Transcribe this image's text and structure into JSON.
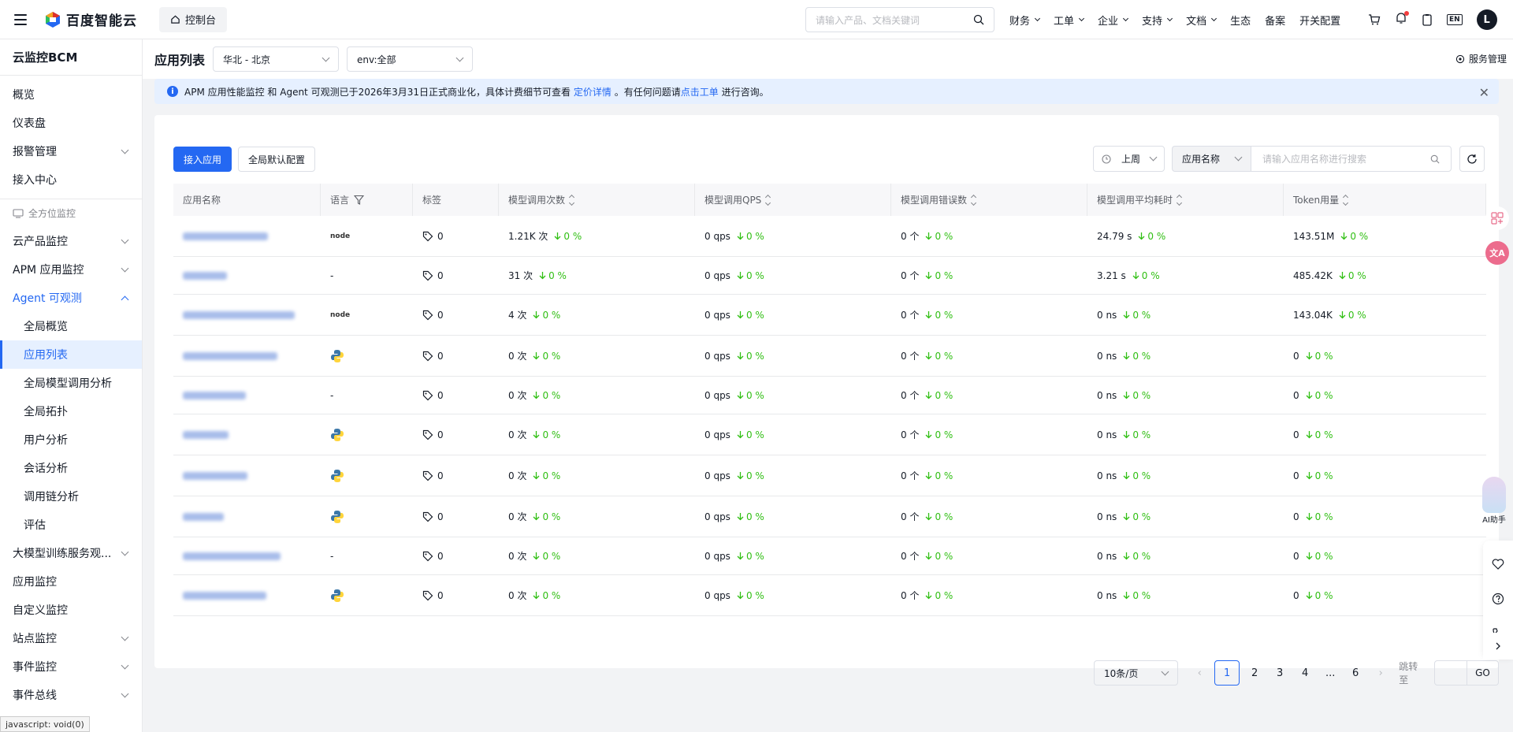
{
  "topbar": {
    "logo_text": "百度智能云",
    "console_label": "控制台",
    "search_placeholder": "请输入产品、文档关键词",
    "nav": [
      {
        "label": "财务",
        "dropdown": true
      },
      {
        "label": "工单",
        "dropdown": true
      },
      {
        "label": "企业",
        "dropdown": true
      },
      {
        "label": "支持",
        "dropdown": true
      },
      {
        "label": "文档",
        "dropdown": true
      },
      {
        "label": "生态",
        "dropdown": false
      },
      {
        "label": "备案",
        "dropdown": false
      },
      {
        "label": "开关配置",
        "dropdown": false
      }
    ],
    "lang_label": "EN",
    "avatar_letter": "L"
  },
  "sidebar": {
    "title": "云监控BCM",
    "items": [
      {
        "label": "概览"
      },
      {
        "label": "仪表盘"
      },
      {
        "label": "报警管理",
        "chevron": true
      },
      {
        "label": "接入中心"
      }
    ],
    "group_label": "全方位监控",
    "items2": [
      {
        "label": "云产品监控",
        "chevron": true
      },
      {
        "label": "APM 应用监控",
        "chevron": true
      },
      {
        "label": "Agent 可观测",
        "chevron": true,
        "open": true
      }
    ],
    "subitems": [
      {
        "label": "全局概览"
      },
      {
        "label": "应用列表",
        "active": true
      },
      {
        "label": "全局模型调用分析"
      },
      {
        "label": "全局拓扑"
      },
      {
        "label": "用户分析"
      },
      {
        "label": "会话分析"
      },
      {
        "label": "调用链分析"
      },
      {
        "label": "评估"
      }
    ],
    "items3": [
      {
        "label": "大模型训练服务观...",
        "chevron": true
      },
      {
        "label": "应用监控"
      },
      {
        "label": "自定义监控"
      },
      {
        "label": "站点监控",
        "chevron": true
      },
      {
        "label": "事件监控",
        "chevron": true
      },
      {
        "label": "事件总线",
        "chevron": true
      }
    ],
    "status_tip": "javascript: void(0)"
  },
  "page": {
    "title": "应用列表",
    "region": "华北 - 北京",
    "env": "env:全部",
    "service_mgmt": "服务管理"
  },
  "notice": {
    "text1": "APM 应用性能监控 和 Agent 可观测已于2026年3月31日正式商业化，具体计费细节可查看",
    "link1": "定价详情",
    "text2": "。有任何问题请",
    "link2": "点击工单",
    "text3": "进行咨询。"
  },
  "toolbar": {
    "add_app": "接入应用",
    "global_config": "全局默认配置",
    "time_range": "上周",
    "search_field": "应用名称",
    "search_placeholder": "请输入应用名称进行搜索"
  },
  "table": {
    "headers": [
      "应用名称",
      "语言",
      "标签",
      "模型调用次数",
      "模型调用QPS",
      "模型调用错误数",
      "模型调用平均耗时",
      "Token用量"
    ],
    "rows": [
      {
        "lang": "node",
        "tags": "0",
        "calls": "1.21K 次",
        "calls_t": "0 %",
        "qps": "0 qps",
        "qps_t": "0 %",
        "err": "0 个",
        "err_t": "0 %",
        "lat": "24.79 s",
        "lat_t": "0 %",
        "tok": "143.51M",
        "tok_t": "0 %"
      },
      {
        "lang": "-",
        "tags": "0",
        "calls": "31 次",
        "calls_t": "0 %",
        "qps": "0 qps",
        "qps_t": "0 %",
        "err": "0 个",
        "err_t": "0 %",
        "lat": "3.21 s",
        "lat_t": "0 %",
        "tok": "485.42K",
        "tok_t": "0 %"
      },
      {
        "lang": "node",
        "tags": "0",
        "calls": "4 次",
        "calls_t": "0 %",
        "qps": "0 qps",
        "qps_t": "0 %",
        "err": "0 个",
        "err_t": "0 %",
        "lat": "0 ns",
        "lat_t": "0 %",
        "tok": "143.04K",
        "tok_t": "0 %"
      },
      {
        "lang": "python",
        "tags": "0",
        "calls": "0 次",
        "calls_t": "0 %",
        "qps": "0 qps",
        "qps_t": "0 %",
        "err": "0 个",
        "err_t": "0 %",
        "lat": "0 ns",
        "lat_t": "0 %",
        "tok": "0",
        "tok_t": "0 %"
      },
      {
        "lang": "-",
        "tags": "0",
        "calls": "0 次",
        "calls_t": "0 %",
        "qps": "0 qps",
        "qps_t": "0 %",
        "err": "0 个",
        "err_t": "0 %",
        "lat": "0 ns",
        "lat_t": "0 %",
        "tok": "0",
        "tok_t": "0 %"
      },
      {
        "lang": "python",
        "tags": "0",
        "calls": "0 次",
        "calls_t": "0 %",
        "qps": "0 qps",
        "qps_t": "0 %",
        "err": "0 个",
        "err_t": "0 %",
        "lat": "0 ns",
        "lat_t": "0 %",
        "tok": "0",
        "tok_t": "0 %"
      },
      {
        "lang": "python",
        "tags": "0",
        "calls": "0 次",
        "calls_t": "0 %",
        "qps": "0 qps",
        "qps_t": "0 %",
        "err": "0 个",
        "err_t": "0 %",
        "lat": "0 ns",
        "lat_t": "0 %",
        "tok": "0",
        "tok_t": "0 %"
      },
      {
        "lang": "python",
        "tags": "0",
        "calls": "0 次",
        "calls_t": "0 %",
        "qps": "0 qps",
        "qps_t": "0 %",
        "err": "0 个",
        "err_t": "0 %",
        "lat": "0 ns",
        "lat_t": "0 %",
        "tok": "0",
        "tok_t": "0 %"
      },
      {
        "lang": "-",
        "tags": "0",
        "calls": "0 次",
        "calls_t": "0 %",
        "qps": "0 qps",
        "qps_t": "0 %",
        "err": "0 个",
        "err_t": "0 %",
        "lat": "0 ns",
        "lat_t": "0 %",
        "tok": "0",
        "tok_t": "0 %"
      },
      {
        "lang": "python",
        "tags": "0",
        "calls": "0 次",
        "calls_t": "0 %",
        "qps": "0 qps",
        "qps_t": "0 %",
        "err": "0 个",
        "err_t": "0 %",
        "lat": "0 ns",
        "lat_t": "0 %",
        "tok": "0",
        "tok_t": "0 %"
      }
    ]
  },
  "pager": {
    "page_size": "10条/页",
    "pages": [
      "1",
      "2",
      "3",
      "4",
      "...",
      "6"
    ],
    "current": "1",
    "jump_label": "跳转至",
    "go": "GO"
  },
  "float": {
    "ai_label": "AI助手"
  },
  "colors": {
    "accent": "#2468f2",
    "trend_down": "#30bf13",
    "notice_bg": "#e6f0ff"
  }
}
